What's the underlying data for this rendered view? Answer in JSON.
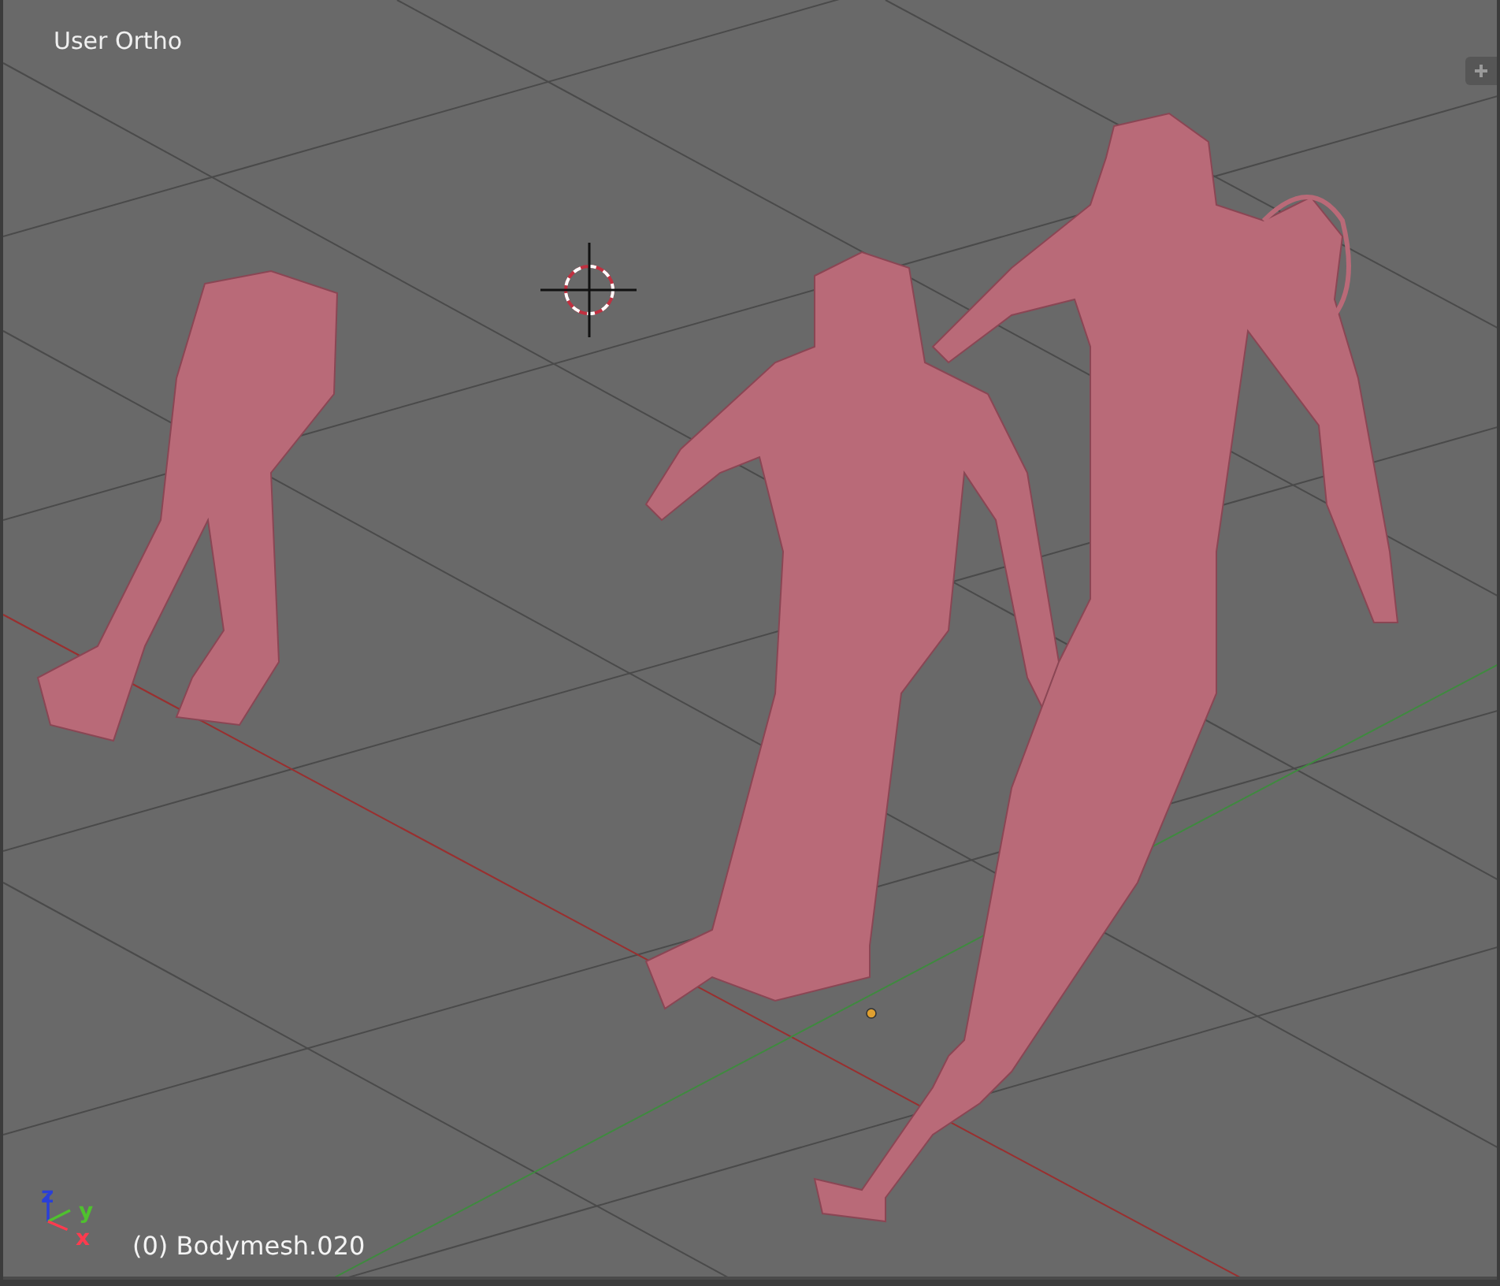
{
  "viewport": {
    "title": "User Ortho",
    "object_label": "(0) Bodymesh.020",
    "axes": [
      {
        "label": "z",
        "color": "#2a3fd8"
      },
      {
        "label": "y",
        "color": "#4fc12f"
      },
      {
        "label": "x",
        "color": "#ff3b4e"
      }
    ]
  }
}
